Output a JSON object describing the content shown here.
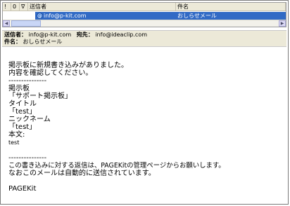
{
  "list": {
    "headers": {
      "col1": "!",
      "col2": "0",
      "col3": "∇",
      "sender": "送信者",
      "subject": "件名"
    },
    "selected_row": {
      "sender": "info@p-kit.com",
      "subject": "おしらせメール"
    }
  },
  "header": {
    "sender_label": "送信者：",
    "sender_value": "info@p-kit.com",
    "to_label": "宛先：",
    "to_value": "info@ideaclip.com",
    "subject_label": "件名：",
    "subject_value": "おしらせメール"
  },
  "body": {
    "lines": [
      "掲示板に新規書き込みがありました。",
      "内容を確認してください。",
      "---------------",
      "掲示板",
      "「サポート掲示板」",
      "タイトル",
      "「test」",
      "ニックネーム",
      "「test」",
      "本文:",
      "test",
      "",
      "---------------",
      "この書き込みに対する返信は、PAGEKitの管理ページからお願いします。",
      "なおこのメールは自動的に送信されています。",
      "",
      "PAGEKit"
    ]
  },
  "colors": {
    "selection": "#316ac5",
    "header_bg": "#ece9d8"
  },
  "icons": {
    "mail": "mail-icon",
    "scroll_left": "scroll-left-icon",
    "scroll_right": "scroll-right-icon"
  }
}
